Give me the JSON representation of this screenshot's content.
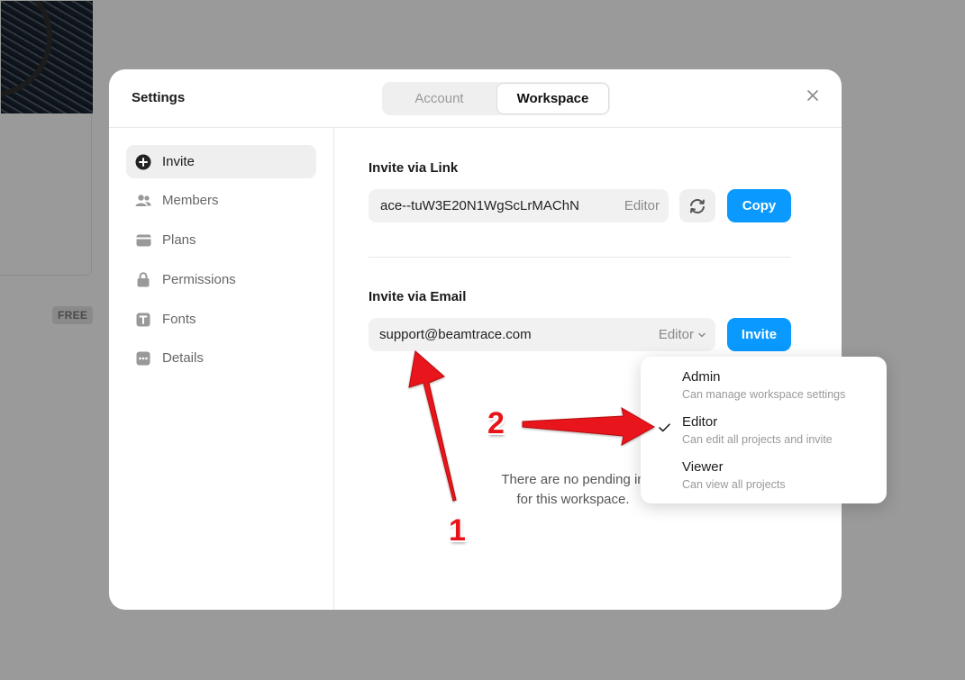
{
  "background": {
    "badge": "FREE"
  },
  "modal": {
    "title": "Settings",
    "tabs": [
      {
        "label": "Account",
        "active": false
      },
      {
        "label": "Workspace",
        "active": true
      }
    ],
    "close_icon": "close-icon"
  },
  "sidebar": {
    "items": [
      {
        "label": "Invite",
        "icon": "plus-circle-icon",
        "active": true
      },
      {
        "label": "Members",
        "icon": "users-icon",
        "active": false
      },
      {
        "label": "Plans",
        "icon": "card-icon",
        "active": false
      },
      {
        "label": "Permissions",
        "icon": "lock-icon",
        "active": false
      },
      {
        "label": "Fonts",
        "icon": "font-icon",
        "active": false
      },
      {
        "label": "Details",
        "icon": "more-icon",
        "active": false
      }
    ]
  },
  "invite_link": {
    "title": "Invite via Link",
    "value": "ace--tuW3E20N1WgScLrMAChN",
    "role": "Editor",
    "refresh_icon": "refresh-icon",
    "copy_label": "Copy"
  },
  "invite_email": {
    "title": "Invite via Email",
    "value": "support@beamtrace.com",
    "role": "Editor",
    "invite_label": "Invite",
    "empty_line1": "There are no pending in",
    "empty_line2": "for this workspace."
  },
  "role_dropdown": {
    "options": [
      {
        "label": "Admin",
        "description": "Can manage workspace settings",
        "selected": false
      },
      {
        "label": "Editor",
        "description": "Can edit all projects and invite",
        "selected": true
      },
      {
        "label": "Viewer",
        "description": "Can view all projects",
        "selected": false
      }
    ]
  },
  "annotations": {
    "marker1": "1",
    "marker2": "2",
    "color": "#e8141a"
  },
  "colors": {
    "primary": "#0a99ff",
    "overlay": "#9a9a9a"
  }
}
